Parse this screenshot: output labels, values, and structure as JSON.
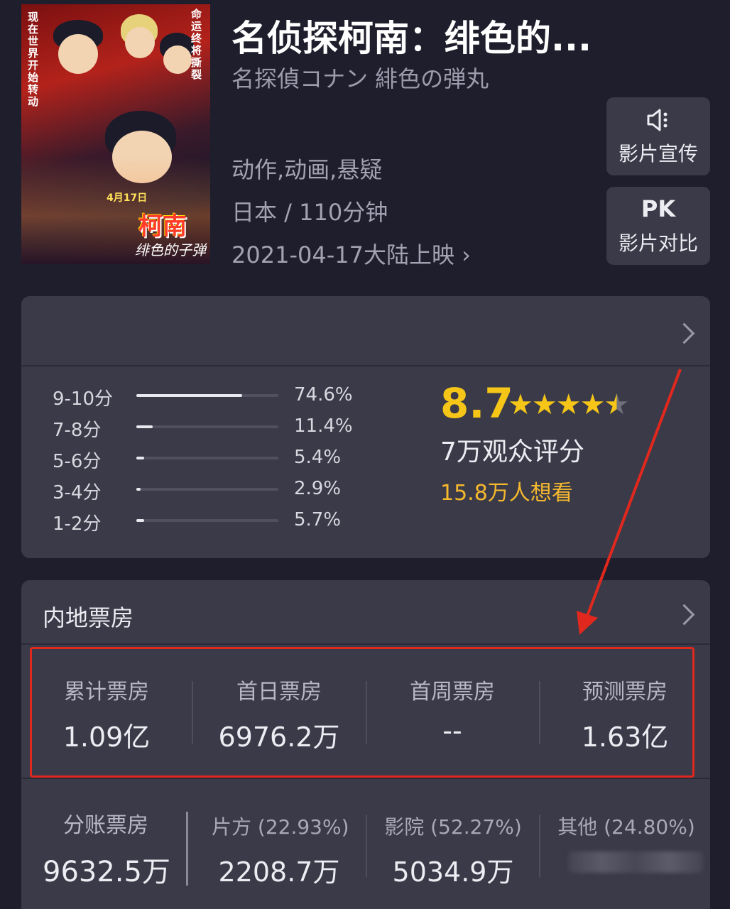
{
  "movie": {
    "title": "名侦探柯南：绯色的...",
    "original_title": "名探偵コナン 緋色の弾丸",
    "genres": "动作,动画,悬疑",
    "country_duration": "日本 / 110分钟",
    "release": "2021-04-17大陆上映 ›",
    "poster": {
      "vertical_text_left": "现在世界开始转动",
      "vertical_text_right": "命运终将撕裂",
      "date_tag": "4月17日",
      "logo": "柯南",
      "subtitle": "绯色的子弹"
    }
  },
  "side_buttons": {
    "promo": {
      "icon": "speaker-icon",
      "label": "影片宣传"
    },
    "pk": {
      "icon_text": "PK",
      "label": "影片对比"
    }
  },
  "rating": {
    "score": "8.7",
    "stars": 4.5,
    "count_text": "7万观众评分",
    "want_text": "15.8万人想看",
    "distribution": [
      {
        "label": "9-10分",
        "percent": 74.6,
        "text": "74.6%"
      },
      {
        "label": "7-8分",
        "percent": 11.4,
        "text": "11.4%"
      },
      {
        "label": "5-6分",
        "percent": 5.4,
        "text": "5.4%"
      },
      {
        "label": "3-4分",
        "percent": 2.9,
        "text": "2.9%"
      },
      {
        "label": "1-2分",
        "percent": 5.7,
        "text": "5.7%"
      }
    ]
  },
  "box_office": {
    "title": "内地票房",
    "stats": [
      {
        "label": "累计票房",
        "value": "1.09亿"
      },
      {
        "label": "首日票房",
        "value": "6976.2万"
      },
      {
        "label": "首周票房",
        "value": "--"
      },
      {
        "label": "预测票房",
        "value": "1.63亿"
      }
    ],
    "split": {
      "label": "分账票房",
      "value": "9632.5万",
      "parts": [
        {
          "label": "片方 (22.93%)",
          "value": "2208.7万"
        },
        {
          "label": "影院 (52.27%)",
          "value": "5034.9万"
        },
        {
          "label": "其他 (24.80%)",
          "value": ""
        }
      ]
    }
  },
  "colors": {
    "background": "#1e1e2c",
    "card": "#3a3a48",
    "accent_gold": "#f5c518",
    "highlight_red": "#e0281e"
  }
}
